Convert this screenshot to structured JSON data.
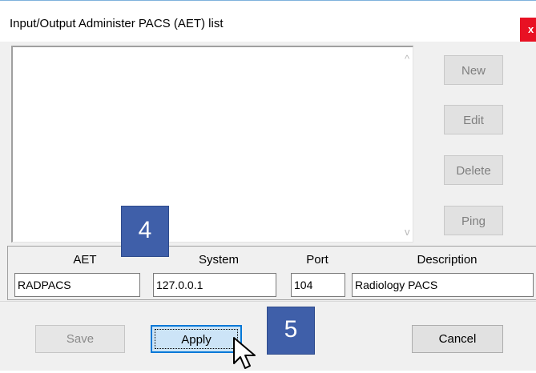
{
  "window": {
    "title": "Input/Output Administer PACS (AET) list",
    "close_glyph": "x",
    "close_icon": "close-icon"
  },
  "side_buttons": {
    "new": "New",
    "edit": "Edit",
    "delete": "Delete",
    "ping": "Ping"
  },
  "scroll": {
    "up_glyph": "^",
    "down_glyph": "v"
  },
  "fields": {
    "aet_label": "AET",
    "aet_value": "RADPACS",
    "system_label": "System",
    "system_value": "127.0.0.1",
    "port_label": "Port",
    "port_value": "104",
    "description_label": "Description",
    "description_value": "Radiology PACS"
  },
  "bottom_buttons": {
    "save": "Save",
    "apply": "Apply",
    "cancel": "Cancel"
  },
  "callouts": {
    "step_4": "4",
    "step_5": "5"
  },
  "colors": {
    "callout": "#3f5fa9",
    "close": "#e81123",
    "focus_border": "#0078d7"
  }
}
